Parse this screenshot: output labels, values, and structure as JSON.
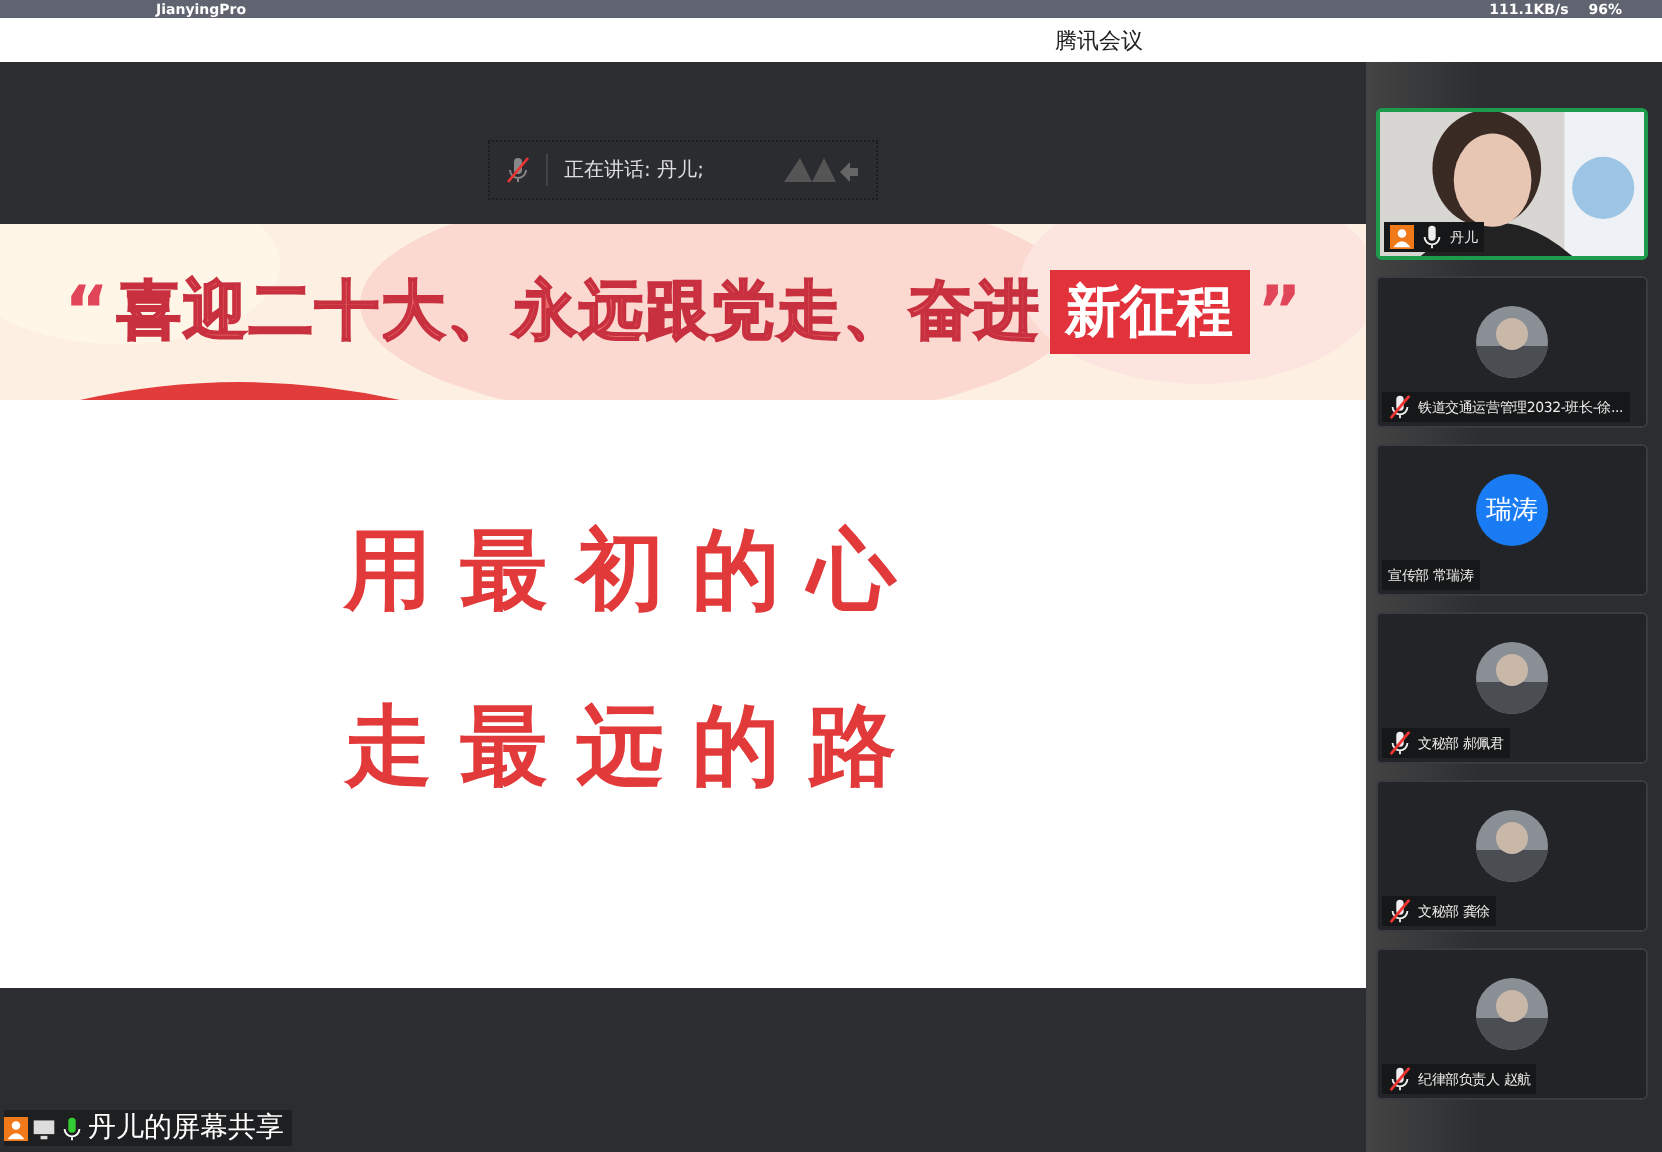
{
  "os_bar": {
    "app_name": "JianyingPro",
    "net_speed": "111.1KB/s",
    "battery": "96%"
  },
  "window": {
    "title": "腾讯会议"
  },
  "speaker": {
    "muted": true,
    "text": "正在讲话: 丹儿;"
  },
  "slide": {
    "quote_open": "“",
    "banner_text": "喜迎二十大、永远跟党走、奋进",
    "banner_highlight": "新征程",
    "quote_close": "”",
    "lines": [
      "用最初的心",
      "走最远的路"
    ]
  },
  "participants": [
    {
      "kind": "video",
      "name": "丹儿",
      "audio": true,
      "muted": false,
      "selected": true,
      "host": true
    },
    {
      "name": "铁道交通运营管理2032-班长-徐...",
      "audio": true,
      "muted": true,
      "selected": false,
      "host": false
    },
    {
      "kind": "initials",
      "initials": "瑞涛",
      "name": "宣传部 常瑞涛",
      "audio": false,
      "selected": false,
      "host": false
    },
    {
      "name": "文秘部 郝佩君",
      "audio": true,
      "muted": true,
      "selected": false,
      "host": false
    },
    {
      "name": "文秘部 龚徐",
      "audio": true,
      "muted": true,
      "selected": false,
      "host": false
    },
    {
      "name": "纪律部负责人 赵航",
      "audio": true,
      "muted": true,
      "selected": false,
      "host": false
    }
  ],
  "share_label": {
    "text": "丹儿的屏幕共享",
    "muted": false
  }
}
